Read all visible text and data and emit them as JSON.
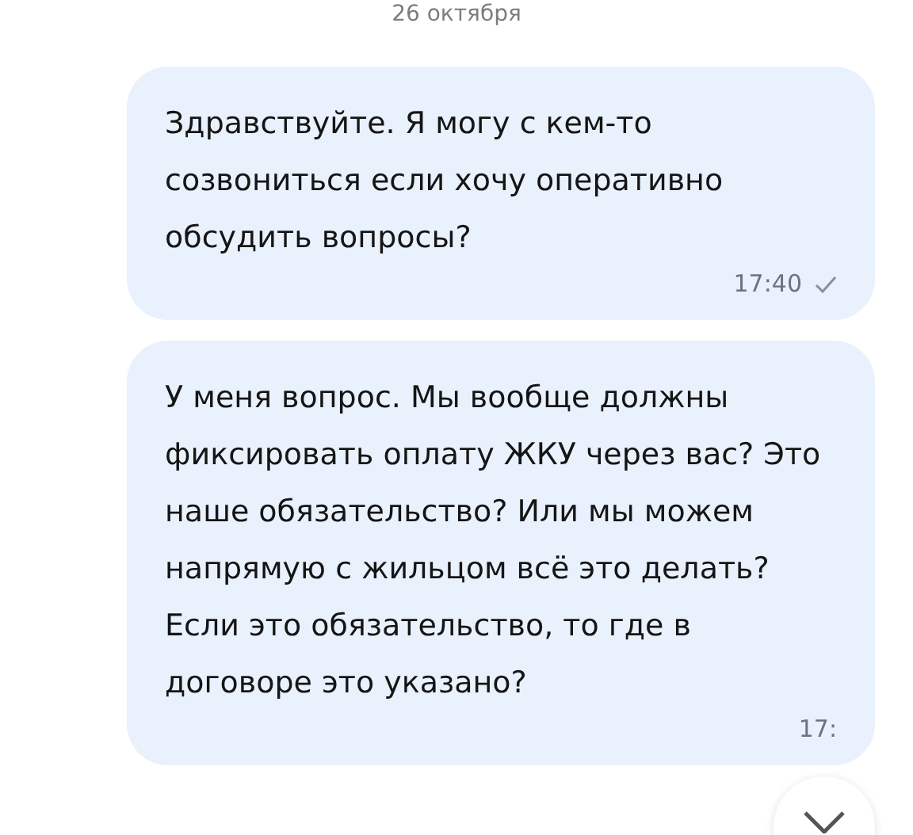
{
  "date": "26 октября",
  "messages": [
    {
      "paragraphs": [
        "Здравствуйте. Я могу с кем-то созвониться если хочу оперативно обсудить вопросы?"
      ],
      "time": "17:40",
      "read": true
    },
    {
      "paragraphs": [
        "У меня вопрос. Мы вообще должны фиксировать оплату ЖКУ через вас? Это наше обязательство? Или мы можем напрямую с жильцом всё это делать?",
        "Если это обязательство, то где в договоре это указано?"
      ],
      "time": "17:"
    }
  ]
}
